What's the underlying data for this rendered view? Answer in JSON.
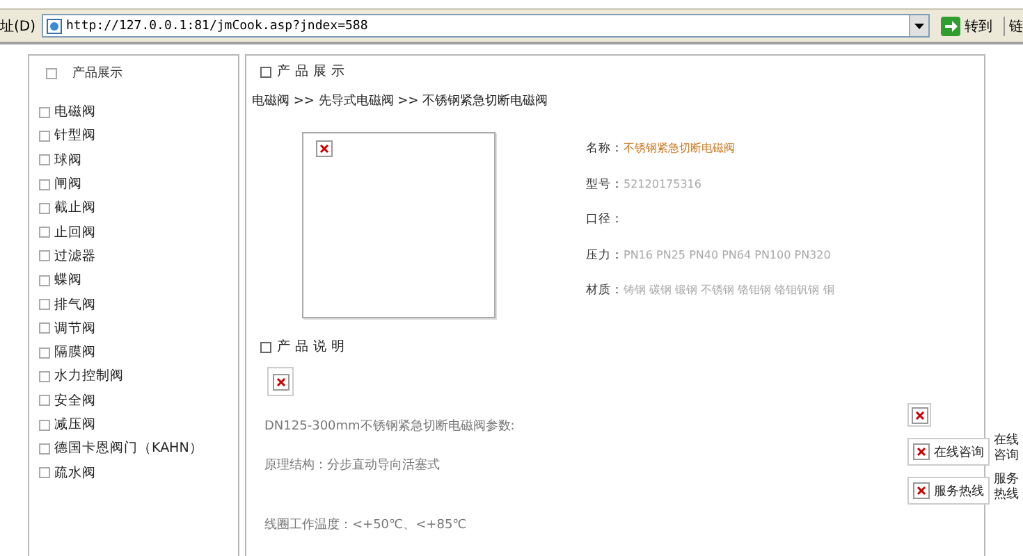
{
  "address_bar": {
    "label": "址(D)",
    "url": "http://127.0.0.1:81/jmCook.asp?jndex=588",
    "go_label": "转到",
    "links_label": "链"
  },
  "sidebar": {
    "title": "产品展示",
    "title_checked": false,
    "items": [
      {
        "label": "电磁阀",
        "checked": false
      },
      {
        "label": "针型阀",
        "checked": false
      },
      {
        "label": "球阀",
        "checked": false
      },
      {
        "label": "闸阀",
        "checked": false
      },
      {
        "label": "截止阀",
        "checked": false
      },
      {
        "label": "止回阀",
        "checked": false
      },
      {
        "label": "过滤器",
        "checked": false
      },
      {
        "label": "蝶阀",
        "checked": false
      },
      {
        "label": "排气阀",
        "checked": false
      },
      {
        "label": "调节阀",
        "checked": false
      },
      {
        "label": "隔膜阀",
        "checked": false
      },
      {
        "label": "水力控制阀",
        "checked": false
      },
      {
        "label": "安全阀",
        "checked": false
      },
      {
        "label": "减压阀",
        "checked": false
      },
      {
        "label": "德国卡恩阀门（KAHN）",
        "checked": false
      },
      {
        "label": "疏水阀",
        "checked": false
      }
    ]
  },
  "product": {
    "heading": "产 品 展 示",
    "breadcrumb": "电磁阀 >> 先导式电磁阀 >> 不锈钢紧急切断电磁阀",
    "specs": [
      {
        "label": "名称：",
        "value": "不锈钢紧急切断电磁阀",
        "highlight": true
      },
      {
        "label": "型号：",
        "value": "52120175316",
        "highlight": false
      },
      {
        "label": "口径："
      },
      {
        "label": "压力：",
        "value": "PN16 PN25 PN40 PN64 PN100 PN320",
        "highlight": false
      },
      {
        "label": "材质：",
        "value": "铸钢 碳钢 锻钢 不锈钢 铬钼钢 铬钼钒钢 铜",
        "highlight": false
      }
    ]
  },
  "description": {
    "heading": "产 品 说 明",
    "lines": [
      "DN125-300mm不锈钢紧急切断电磁阀参数:",
      "原理结构：分步直动导向活塞式",
      "线圈工作温度：<+50℃、<+85℃"
    ]
  },
  "service": [
    {
      "button": "在线咨询",
      "side": "在线咨询"
    },
    {
      "button": "服务热线",
      "side": "服务热线"
    }
  ]
}
